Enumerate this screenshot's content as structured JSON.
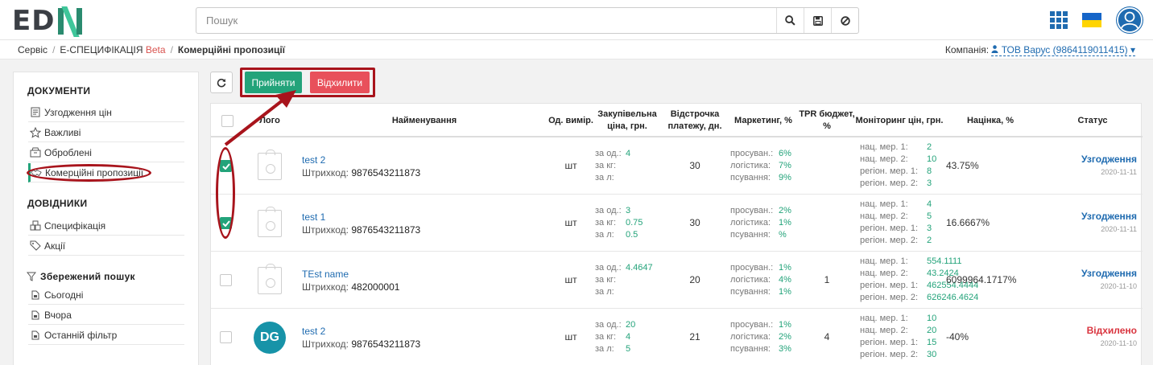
{
  "brand": {
    "logo_text": "ED",
    "logo_n": "N"
  },
  "search": {
    "placeholder": "Пошук"
  },
  "breadcrumb": {
    "items": [
      "Сервіс",
      "Е-СПЕЦИФІКАЦІЯ"
    ],
    "beta": "Beta",
    "current": "Комерційні пропозиції",
    "sep": "/"
  },
  "company": {
    "label": "Компанія:",
    "value": "ТОВ Варус (9864119011415)"
  },
  "sidebar": {
    "docs_title": "ДОКУМЕНТИ",
    "docs": [
      "Узгодження цін",
      "Важливі",
      "Оброблені",
      "Комерційні пропозиції"
    ],
    "refs_title": "ДОВІДНИКИ",
    "refs": [
      "Специфікація",
      "Акції"
    ],
    "saved_title": "Збережений пошук",
    "saved": [
      "Сьогодні",
      "Вчора",
      "Останній фільтр"
    ]
  },
  "toolbar": {
    "accept": "Прийняти",
    "reject": "Відхилити"
  },
  "table": {
    "headers": {
      "logo": "Лого",
      "name": "Найменування",
      "unit": "Од. вимір.",
      "price": "Закупівельна ціна, грн.",
      "delay": "Відстрочка платежу, дн.",
      "marketing": "Маркетинг, %",
      "tpr": "TPR бюджет, %",
      "monitoring": "Моніторинг цін, грн.",
      "markup": "Націнка, %",
      "status": "Статус"
    },
    "labels": {
      "barcode": "Штрихкод:",
      "per_unit": "за од.:",
      "per_kg": "за кг:",
      "per_l": "за л:",
      "promo": "просуван.:",
      "logistics": "логістика:",
      "spoil": "псування:",
      "nat1": "нац. мер. 1:",
      "nat2": "нац. мер. 2:",
      "reg1": "регіон. мер. 1:",
      "reg2": "регіон. мер. 2:"
    },
    "rows": [
      {
        "name": "test 2",
        "barcode": "9876543211873",
        "unit": "шт",
        "p_unit": "4",
        "p_kg": "",
        "p_l": "",
        "delay": "30",
        "promo": "6%",
        "logistics": "7%",
        "spoil": "9%",
        "tpr": "",
        "nat1": "2",
        "nat2": "10",
        "reg1": "8",
        "reg2": "3",
        "markup": "43.75%",
        "status": "Узгодження",
        "date": "2020-11-11"
      },
      {
        "name": "test 1",
        "barcode": "9876543211873",
        "unit": "шт",
        "p_unit": "3",
        "p_kg": "0.75",
        "p_l": "0.5",
        "delay": "30",
        "promo": "2%",
        "logistics": "1%",
        "spoil": "%",
        "tpr": "",
        "nat1": "4",
        "nat2": "5",
        "reg1": "3",
        "reg2": "2",
        "markup": "16.6667%",
        "status": "Узгодження",
        "date": "2020-11-11"
      },
      {
        "name": "TEst name",
        "barcode": "482000001",
        "unit": "шт",
        "p_unit": "4.4647",
        "p_kg": "",
        "p_l": "",
        "delay": "20",
        "promo": "1%",
        "logistics": "4%",
        "spoil": "1%",
        "tpr": "1",
        "nat1": "554.1111",
        "nat2": "43.2424",
        "reg1": "462554.4444",
        "reg2": "626246.4624",
        "markup": "6099964.1717%",
        "status": "Узгодження",
        "date": "2020-11-10"
      },
      {
        "name": "test 2",
        "barcode": "9876543211873",
        "unit": "шт",
        "p_unit": "20",
        "p_kg": "4",
        "p_l": "5",
        "delay": "21",
        "promo": "1%",
        "logistics": "2%",
        "spoil": "3%",
        "tpr": "4",
        "nat1": "10",
        "nat2": "20",
        "reg1": "15",
        "reg2": "30",
        "markup": "-40%",
        "status": "Відхилено",
        "date": "2020-11-10",
        "avatar": "DG"
      }
    ]
  },
  "colors": {
    "accent_green": "#23a37a",
    "reject_red": "#e8505b",
    "link_blue": "#1f6bb0",
    "annotation": "#a8141c"
  }
}
